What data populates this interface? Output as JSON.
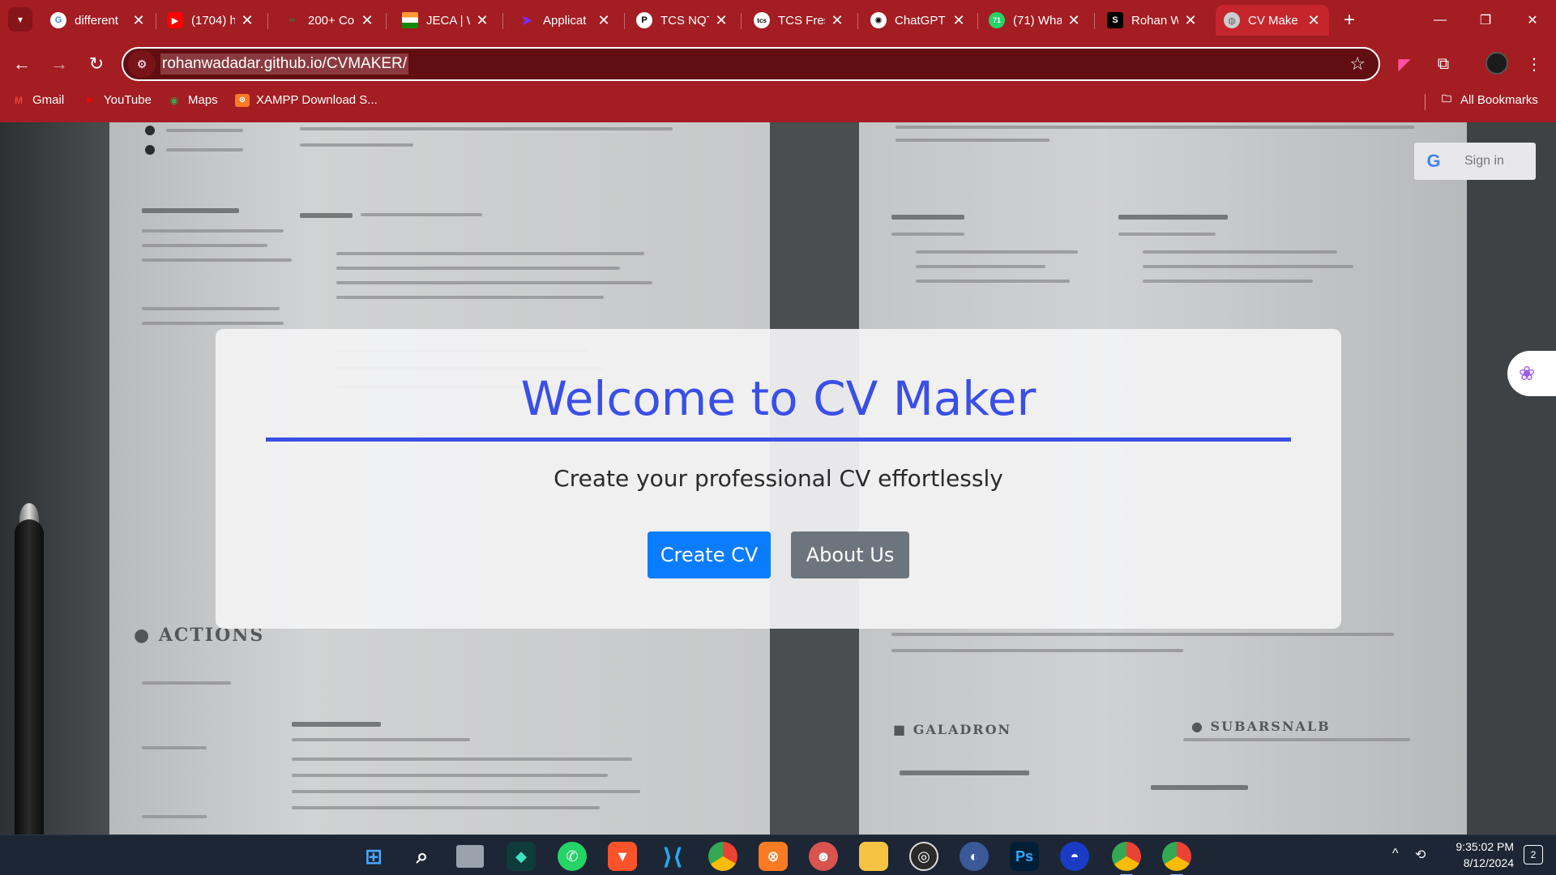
{
  "browser": {
    "tabs": [
      {
        "title": "different",
        "favicon": "google-icon",
        "color": "#ffffff",
        "active": false
      },
      {
        "title": "(1704) h",
        "favicon": "youtube-icon",
        "color": "#ff0000",
        "active": false
      },
      {
        "title": "200+ Co",
        "favicon": "link-icon",
        "color": "#2e7d32",
        "active": false
      },
      {
        "title": "JECA | W",
        "favicon": "india-flag-icon",
        "color": "#ff9933",
        "active": false
      },
      {
        "title": "Applicat",
        "favicon": "arrow-icon",
        "color": "#6a1bff",
        "active": false
      },
      {
        "title": "TCS NQT",
        "favicon": "p-icon",
        "color": "#ffffff",
        "active": false
      },
      {
        "title": "TCS Fres",
        "favicon": "tcs-icon",
        "color": "#ffffff",
        "active": false
      },
      {
        "title": "ChatGPT",
        "favicon": "chatgpt-icon",
        "color": "#ffffff",
        "active": false
      },
      {
        "title": "(71) Wha",
        "favicon": "whatsapp-icon",
        "color": "#25d366",
        "active": false
      },
      {
        "title": "Rohan W",
        "favicon": "s-icon",
        "color": "#000000",
        "active": false
      },
      {
        "title": "CV Make",
        "favicon": "globe-icon",
        "color": "#cccccc",
        "active": true
      }
    ],
    "url": "rohanwadadar.github.io/CVMAKER/",
    "bookmarks": [
      {
        "label": "Gmail",
        "icon": "gmail-icon"
      },
      {
        "label": "YouTube",
        "icon": "youtube-icon"
      },
      {
        "label": "Maps",
        "icon": "maps-icon"
      },
      {
        "label": "XAMPP Download S...",
        "icon": "xampp-icon"
      }
    ],
    "all_bookmarks": "All Bookmarks",
    "accent": "#a31d22"
  },
  "page": {
    "signin": "Sign in",
    "modal": {
      "title": "Welcome to CV Maker",
      "tagline": "Create your professional CV effortlessly",
      "primary_button": "Create CV",
      "secondary_button": "About Us",
      "title_color": "#3a4fe6",
      "primary_color": "#0a7cff",
      "secondary_color": "#6c757d"
    }
  },
  "taskbar": {
    "apps": [
      "windows-start-icon",
      "search-icon",
      "task-view-icon",
      "filmora-icon",
      "whatsapp-icon",
      "brave-icon",
      "vscode-icon",
      "chrome-icon",
      "xampp-icon",
      "game-icon",
      "file-explorer-icon",
      "obs-icon",
      "browser-icon",
      "photoshop-icon",
      "app-icon",
      "chrome-icon",
      "chrome-profile-icon"
    ],
    "time": "9:35:02 PM",
    "date": "8/12/2024",
    "notifications": "2"
  }
}
